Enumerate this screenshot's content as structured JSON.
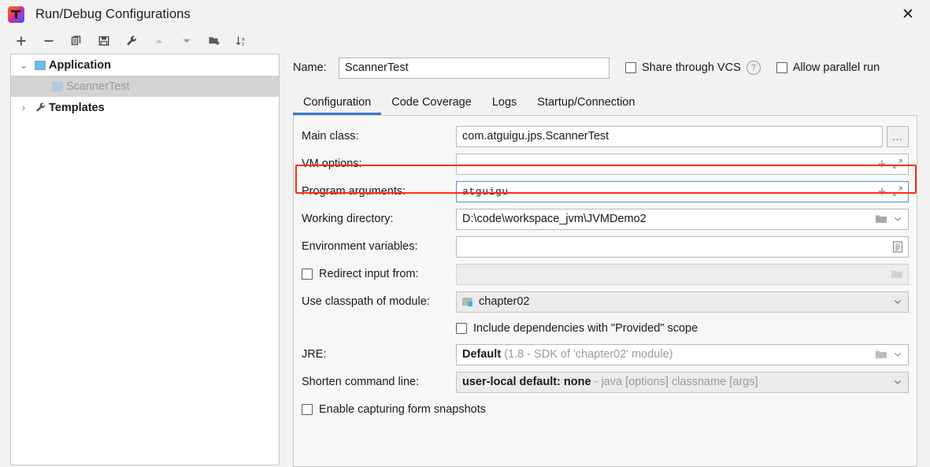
{
  "window": {
    "title": "Run/Debug Configurations",
    "logo_icon": "intellij-idea-logo",
    "close_icon": "✕"
  },
  "toolbar": {
    "items": [
      {
        "name": "add-configuration",
        "glyph": "+",
        "disabled": false
      },
      {
        "name": "remove-configuration",
        "glyph": "−",
        "disabled": false
      },
      {
        "name": "copy-configuration",
        "glyph": "copy",
        "disabled": false
      },
      {
        "name": "save-configuration",
        "glyph": "save",
        "disabled": false
      },
      {
        "name": "edit-templates",
        "glyph": "wrench",
        "disabled": false
      },
      {
        "name": "move-up",
        "glyph": "▲",
        "disabled": true
      },
      {
        "name": "move-down",
        "glyph": "▼",
        "disabled": false
      },
      {
        "name": "new-folder",
        "glyph": "folder-add",
        "disabled": false
      },
      {
        "name": "sort-alphabetically",
        "glyph": "sort-az",
        "disabled": false
      }
    ]
  },
  "tree": {
    "nodes": [
      {
        "label": "Application",
        "expanded": true,
        "chevron": "⌄",
        "icon": "application-icon",
        "bold": true,
        "selected": false
      },
      {
        "label": "ScannerTest",
        "expanded": false,
        "chevron": "",
        "icon": "application-icon-pale",
        "bold": false,
        "selected": true
      },
      {
        "label": "Templates",
        "expanded": false,
        "chevron": "›",
        "icon": "wrench-icon",
        "bold": true,
        "selected": false
      }
    ]
  },
  "header": {
    "name_label": "Name:",
    "name_value": "ScannerTest",
    "share_vcs_label": "Share through VCS",
    "share_vcs_checked": false,
    "help_glyph": "?",
    "allow_parallel_label": "Allow parallel run",
    "allow_parallel_checked": false
  },
  "tabs": {
    "items": [
      {
        "label": "Configuration",
        "active": true
      },
      {
        "label": "Code Coverage",
        "active": false
      },
      {
        "label": "Logs",
        "active": false
      },
      {
        "label": "Startup/Connection",
        "active": false
      }
    ],
    "accent_color": "#3b78c4"
  },
  "form": {
    "main_class": {
      "label": "Main class:",
      "value": "com.atguigu.jps.ScannerTest",
      "browse_label": "..."
    },
    "vm_options": {
      "label": "VM options:",
      "value": "",
      "add_icon": "plus-icon",
      "expand_icon": "expand-icon"
    },
    "program_arguments": {
      "label": "Program arguments:",
      "value": "atguigu",
      "add_icon": "plus-icon",
      "expand_icon": "expand-icon",
      "focused": true,
      "highlight_color": "#ff2d16"
    },
    "working_directory": {
      "label": "Working directory:",
      "value": "D:\\code\\workspace_jvm\\JVMDemo2",
      "folder_icon": "folder-icon",
      "chevron_icon": "chevron-down-icon"
    },
    "environment_variables": {
      "label": "Environment variables:",
      "value": "",
      "list_icon": "list-icon"
    },
    "redirect_input": {
      "label": "Redirect input from:",
      "checked": false,
      "value": "",
      "folder_icon": "folder-icon"
    },
    "use_classpath_of_module": {
      "label": "Use classpath of module:",
      "value": "chapter02",
      "module_icon": "module-folder-icon",
      "chevron_icon": "chevron-down-icon"
    },
    "include_provided": {
      "label": "Include dependencies with \"Provided\" scope",
      "checked": false
    },
    "jre": {
      "label": "JRE:",
      "value": "Default",
      "value_note": "(1.8 - SDK of 'chapter02' module)",
      "folder_icon": "folder-icon",
      "chevron_icon": "chevron-down-icon"
    },
    "shorten_command_line": {
      "label": "Shorten command line:",
      "value": "user-local default: none",
      "value_note": "- java [options] classname [args]",
      "chevron_icon": "chevron-down-icon"
    },
    "form_snapshots": {
      "label": "Enable capturing form snapshots",
      "checked": false
    }
  }
}
